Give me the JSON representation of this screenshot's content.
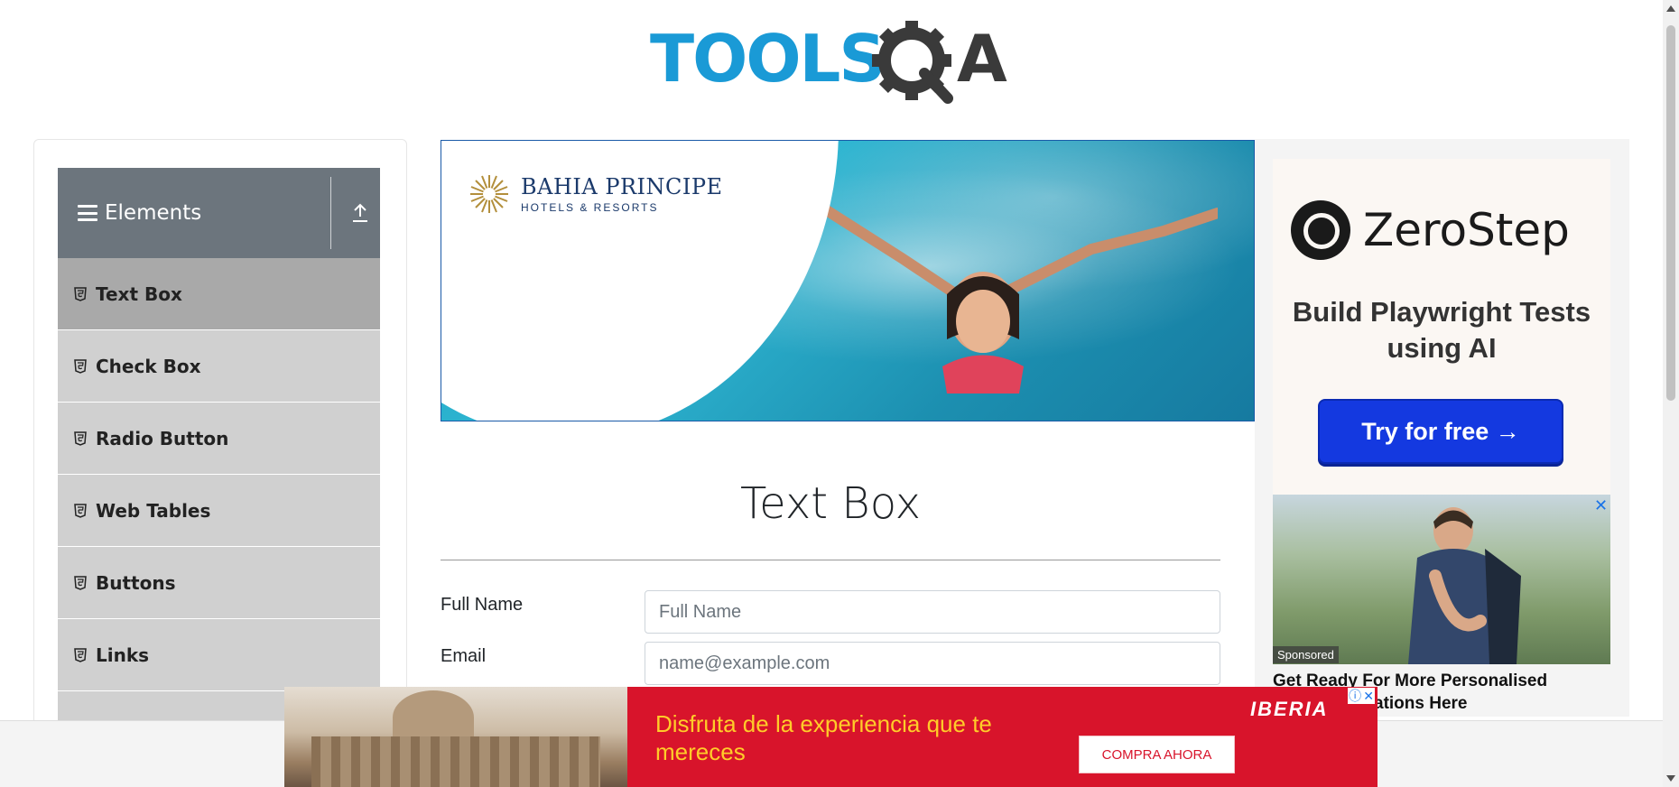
{
  "header": {
    "logo_text": "TOOLSQA"
  },
  "sidebar": {
    "group_title": "Elements",
    "items": [
      {
        "label": "Text Box",
        "active": true
      },
      {
        "label": "Check Box"
      },
      {
        "label": "Radio Button"
      },
      {
        "label": "Web Tables"
      },
      {
        "label": "Buttons"
      },
      {
        "label": "Links"
      }
    ]
  },
  "top_ad": {
    "brand": "BAHIA PRINCIPE",
    "sub": "HOTELS & RESORTS"
  },
  "main": {
    "title": "Text Box",
    "full_name": {
      "label": "Full Name",
      "placeholder": "Full Name"
    },
    "email": {
      "label": "Email",
      "placeholder": "name@example.com"
    }
  },
  "right_ad": {
    "brand": "ZeroStep",
    "tagline": "Build Playwright Tests using AI",
    "cta": "Try for free →",
    "sponsored": "Sponsored",
    "caption": "Get Ready For More Personalised",
    "caption_2": "ations Here",
    "close": "✕"
  },
  "bottom_ad": {
    "message": "Disfruta de la experiencia que te mereces",
    "brand": "IBERIA",
    "cta": "COMPRA AHORA",
    "info": "ⓘ",
    "close": "✕"
  },
  "colors": {
    "sidebar_header": "#6c757d",
    "active_item": "#a9a9a9",
    "item": "#d0d0d0",
    "accent": "#1439e0",
    "iberia_red": "#d8142b"
  }
}
